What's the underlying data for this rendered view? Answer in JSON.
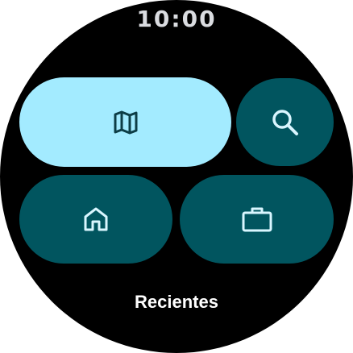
{
  "status": {
    "time": "10:00"
  },
  "tiles": [
    {
      "name": "maps",
      "icon": "map-icon",
      "background": "#a3ebff",
      "icon_color": "#0d3d46"
    },
    {
      "name": "search",
      "icon": "search-icon",
      "background": "#01555f",
      "icon_color": "#d9f6ff"
    },
    {
      "name": "home",
      "icon": "home-icon",
      "background": "#01555f",
      "icon_color": "#d9f6ff"
    },
    {
      "name": "work",
      "icon": "briefcase-icon",
      "background": "#01555f",
      "icon_color": "#d9f6ff"
    }
  ],
  "recents_label": "Recientes",
  "colors": {
    "background": "#000000",
    "time_text": "#dadce0",
    "label_text": "#ffffff"
  }
}
